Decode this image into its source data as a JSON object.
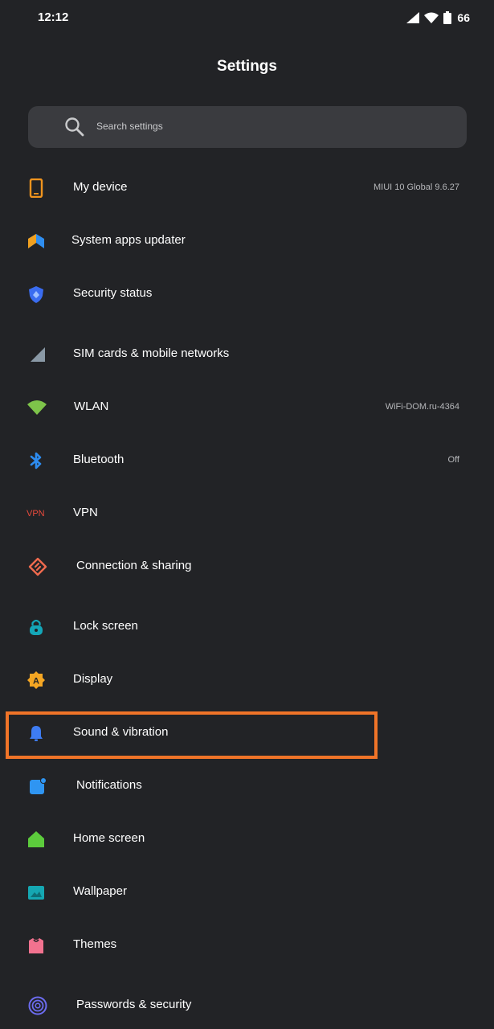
{
  "status_bar": {
    "time": "12:12",
    "battery": "66"
  },
  "header": {
    "title": "Settings"
  },
  "search": {
    "placeholder": "Search settings"
  },
  "items": [
    {
      "label": "My device",
      "value": "MIUI 10 Global 9.6.27",
      "icon": "phone-icon",
      "color": "#f0941e"
    },
    {
      "label": "System apps updater",
      "icon": "updater-icon",
      "color": "#2f8ef0"
    },
    {
      "label": "Security status",
      "icon": "shield-icon",
      "color": "#3a6cf0"
    },
    {
      "label": "SIM cards & mobile networks",
      "icon": "sim-signal-icon",
      "color": "#8a99a6"
    },
    {
      "label": "WLAN",
      "value": "WiFi-DOM.ru-4364",
      "icon": "wifi-icon",
      "color": "#7ec44a"
    },
    {
      "label": "Bluetooth",
      "value": "Off",
      "icon": "bluetooth-icon",
      "color": "#2d8cf0"
    },
    {
      "label": "VPN",
      "icon": "vpn-icon",
      "icon_text": "VPN",
      "color": "#e84a3c"
    },
    {
      "label": "Connection & sharing",
      "icon": "connection-icon",
      "color": "#ef6a4e"
    },
    {
      "label": "Lock screen",
      "icon": "lock-icon",
      "color": "#14a6b8"
    },
    {
      "label": "Display",
      "icon": "display-icon",
      "icon_text": "A",
      "color": "#f5a623"
    },
    {
      "label": "Sound & vibration",
      "icon": "bell-icon",
      "color": "#3e7cf2"
    },
    {
      "label": "Notifications",
      "icon": "notifications-icon",
      "color": "#2f95f2"
    },
    {
      "label": "Home screen",
      "icon": "home-icon",
      "color": "#5ccb3c"
    },
    {
      "label": "Wallpaper",
      "icon": "wallpaper-icon",
      "color": "#15a7b2"
    },
    {
      "label": "Themes",
      "icon": "themes-icon",
      "color": "#f2728f"
    },
    {
      "label": "Passwords & security",
      "icon": "fingerprint-icon",
      "color": "#6c6cf0"
    }
  ],
  "highlight": {
    "target": "Sound & vibration",
    "color": "#f07428"
  }
}
